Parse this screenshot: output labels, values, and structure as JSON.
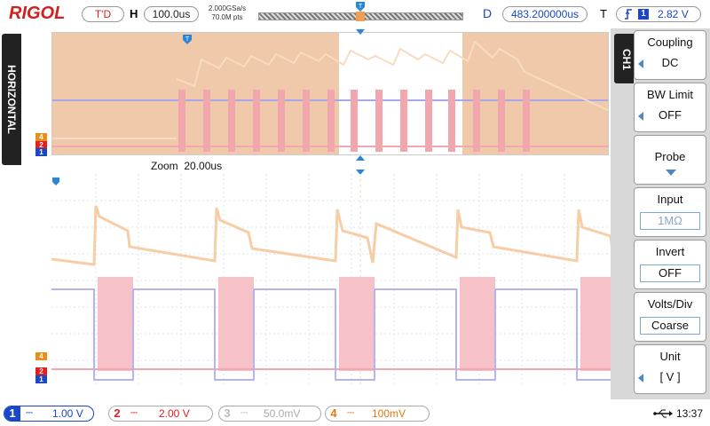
{
  "brand": "RIGOL",
  "trigger_status": "T'D",
  "horizontal": {
    "label": "H",
    "timebase": "100.0us",
    "sample_rate": "2.000GSa/s",
    "memory_depth": "70.0M pts",
    "tab_label": "HORIZONTAL",
    "zoom_label": "Zoom",
    "zoom_timebase": "20.00us"
  },
  "delay": {
    "label": "D",
    "value": "483.200000us"
  },
  "trigger": {
    "label": "T",
    "source": "1",
    "level": "2.82 V"
  },
  "side_menu": {
    "channel_tab": "CH1",
    "items": [
      {
        "title": "Coupling",
        "value": "DC"
      },
      {
        "title": "BW Limit",
        "value": "OFF"
      },
      {
        "title": "Probe",
        "value": ""
      },
      {
        "title": "Input",
        "value": "1MΩ"
      },
      {
        "title": "Invert",
        "value": "OFF"
      },
      {
        "title": "Volts/Div",
        "value": "Coarse"
      },
      {
        "title": "Unit",
        "value": "[ V ]"
      }
    ]
  },
  "channels": [
    {
      "num": "1",
      "scale": "1.00 V",
      "color": "#1a46c8"
    },
    {
      "num": "2",
      "scale": "2.00 V",
      "color": "#e02020"
    },
    {
      "num": "3",
      "scale": "50.0mV",
      "color": "#aaaaaa"
    },
    {
      "num": "4",
      "scale": "100mV",
      "color": "#e07a10"
    }
  ],
  "waveform_markers": {
    "ch4": "4",
    "ch2": "2",
    "ch1": "1"
  },
  "colors": {
    "ch1": "#a9a6f0",
    "ch2": "#f2a6ae",
    "ch4": "#f7c9a0",
    "overview_bg": "#f0c8aa",
    "marker_blue": "#1a46c8",
    "marker_orange": "#e6901a",
    "marker_red": "#e02020",
    "trigger_marker": "#2a86d6"
  },
  "status": {
    "time": "13:37",
    "usb": "usb-icon"
  }
}
